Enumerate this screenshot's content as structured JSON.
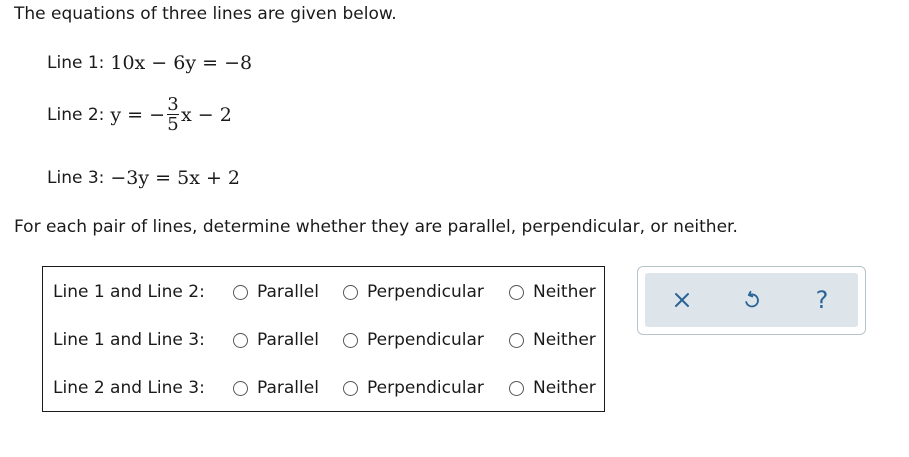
{
  "intro": "The equations of three lines are given below.",
  "lines": [
    {
      "label": "Line 1:",
      "equation": "10x − 6y = −8"
    },
    {
      "label": "Line 2:",
      "lhs": "y = −",
      "frac_num": "3",
      "frac_den": "5",
      "rhs": "x − 2"
    },
    {
      "label": "Line 3:",
      "equation": "−3y = 5x + 2"
    }
  ],
  "instruction": "For each pair of lines, determine whether they are parallel, perpendicular, or neither.",
  "question": {
    "rows": [
      {
        "label": "Line 1 and Line 2:",
        "options": [
          "Parallel",
          "Perpendicular",
          "Neither"
        ]
      },
      {
        "label": "Line 1 and Line 3:",
        "options": [
          "Parallel",
          "Perpendicular",
          "Neither"
        ]
      },
      {
        "label": "Line 2 and Line 3:",
        "options": [
          "Parallel",
          "Perpendicular",
          "Neither"
        ]
      }
    ]
  },
  "toolbar": {
    "clear_icon": "close-icon",
    "undo_icon": "undo-icon",
    "help_label": "?",
    "icon_color": "#2a6496"
  }
}
